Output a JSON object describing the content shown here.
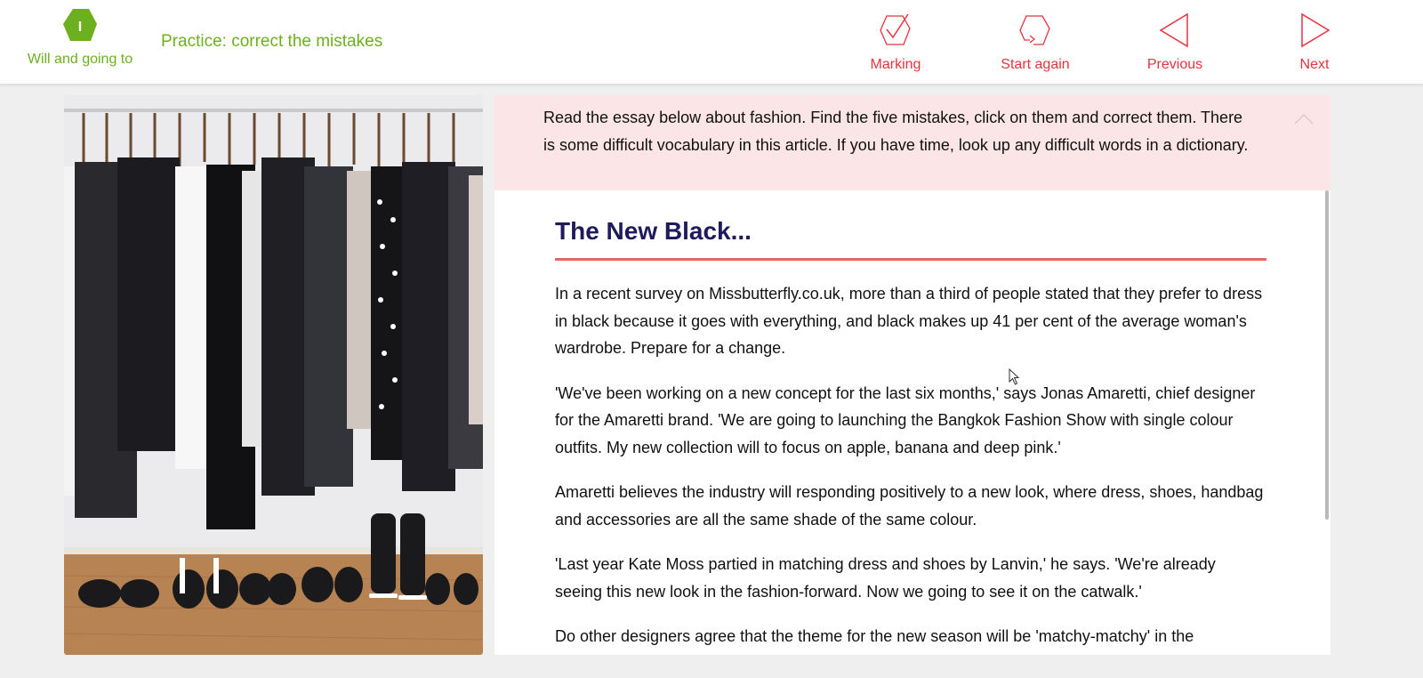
{
  "header": {
    "unit_badge": "I",
    "unit_label": "Will and going to",
    "title": "Practice: correct the mistakes",
    "buttons": {
      "marking": "Marking",
      "start_again": "Start again",
      "previous": "Previous",
      "next": "Next"
    }
  },
  "colors": {
    "accent_green": "#6cb01f",
    "accent_red": "#e8323c",
    "heading_navy": "#1f1a5c",
    "instructions_bg": "#fce5e6"
  },
  "instructions": "Read the essay below about fashion. Find the five mistakes, click on them and correct them. There is some difficult vocabulary in this article. If you have time, look up any difficult words in a dictionary.",
  "essay": {
    "title": "The New Black...",
    "paragraphs": [
      "In a recent survey on Missbutterfly.co.uk, more than a third of people stated that they prefer to dress in black because it goes with everything, and black makes up 41 per cent of the average woman's wardrobe. Prepare for a change.",
      "'We've been working on a new concept for the last six months,' says Jonas Amaretti, chief designer for the Amaretti brand. 'We are going to launching the Bangkok Fashion Show with single colour outfits. My new collection will to focus on apple, banana and deep pink.'",
      "Amaretti believes the industry will responding positively to a new look, where dress, shoes, handbag and accessories are all the same shade of the same colour.",
      "'Last year Kate Moss partied in matching dress and shoes by Lanvin,' he says. 'We're already seeing this new look in the fashion-forward. Now we going to see it on the catwalk.'",
      "Do other designers agree that the theme for the new season will be 'matchy-matchy' in the"
    ]
  },
  "image": {
    "subject": "clothes rail with black and white garments and a row of shoes"
  }
}
